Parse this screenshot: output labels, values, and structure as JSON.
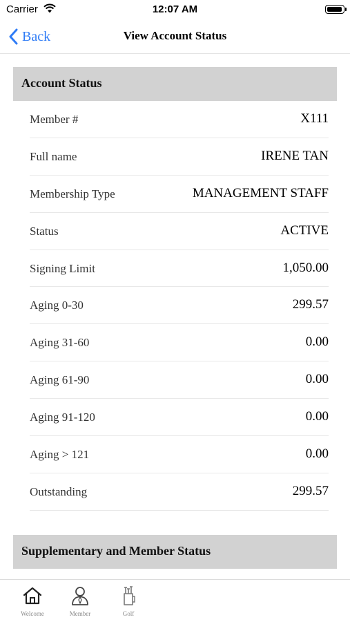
{
  "status_bar": {
    "carrier": "Carrier",
    "time": "12:07 AM"
  },
  "nav": {
    "back_label": "Back",
    "title": "View Account Status"
  },
  "account_section": {
    "title": "Account Status",
    "rows": [
      {
        "label": "Member #",
        "value": "X111"
      },
      {
        "label": "Full name",
        "value": "IRENE TAN"
      },
      {
        "label": "Membership Type",
        "value": "MANAGEMENT STAFF"
      },
      {
        "label": "Status",
        "value": "ACTIVE"
      },
      {
        "label": "Signing Limit",
        "value": "1,050.00"
      },
      {
        "label": "Aging 0-30",
        "value": "299.57"
      },
      {
        "label": "Aging 31-60",
        "value": "0.00"
      },
      {
        "label": "Aging 61-90",
        "value": "0.00"
      },
      {
        "label": "Aging 91-120",
        "value": "0.00"
      },
      {
        "label": "Aging > 121",
        "value": "0.00"
      },
      {
        "label": "Outstanding",
        "value": "299.57"
      }
    ]
  },
  "supplementary_section": {
    "title": "Supplementary and Member Status"
  },
  "tabs": [
    {
      "label": "Welcome",
      "icon": "home-icon"
    },
    {
      "label": "Member",
      "icon": "user-icon"
    },
    {
      "label": "Golf",
      "icon": "golf-bag-icon"
    }
  ],
  "colors": {
    "accent": "#2f7cf6",
    "section_header_bg": "#d2d2d2",
    "tab_inactive": "#8a8a8a"
  }
}
